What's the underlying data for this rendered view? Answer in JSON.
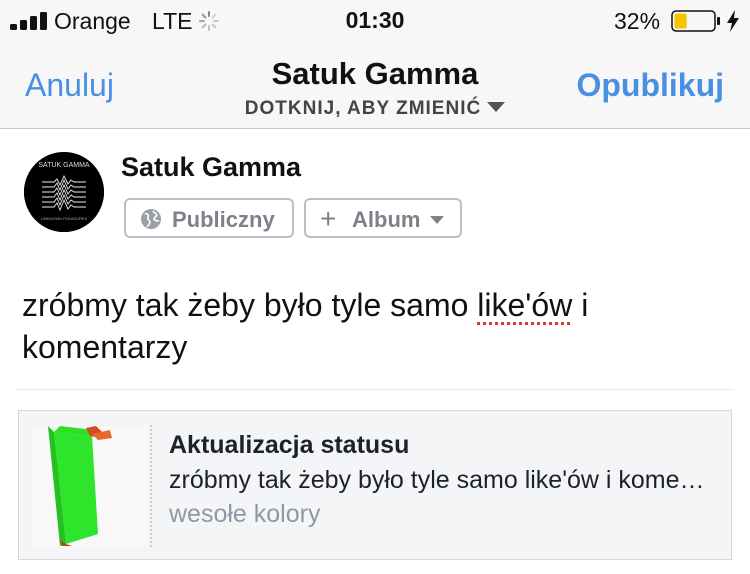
{
  "status_bar": {
    "carrier": "Orange",
    "network": "LTE",
    "time": "01:30",
    "battery_percent": "32%",
    "battery_level": 0.32,
    "battery_color": "#f5c400",
    "signal_bars": 4
  },
  "nav": {
    "cancel_label": "Anuluj",
    "title": "Satuk Gamma",
    "subtitle": "DOTKNIJ, ABY ZMIENIĆ",
    "publish_label": "Opublikuj",
    "accent_color": "#4a90e2"
  },
  "composer": {
    "user_name": "Satuk Gamma",
    "avatar_text": "SATUK GAMMA",
    "avatar_subtext": "UNKNOWN PLEASURES",
    "audience_label": "Publiczny",
    "album_label": "Album",
    "post_text_before": "zróbmy tak żeby było tyle samo ",
    "post_text_misspelled": "like'ów",
    "post_text_after": " i komentarzy"
  },
  "preview": {
    "title": "Aktualizacja statusu",
    "description": "zróbmy tak żeby było tyle samo like'ów i komentarzy",
    "caption": "wesołe kolory"
  },
  "icons": {
    "signal": "signal-icon",
    "loading": "spinner-icon",
    "battery": "battery-icon",
    "charging": "bolt-icon",
    "audience": "globe-icon",
    "album_add": "plus-icon",
    "dropdown": "chevron-down-icon"
  }
}
